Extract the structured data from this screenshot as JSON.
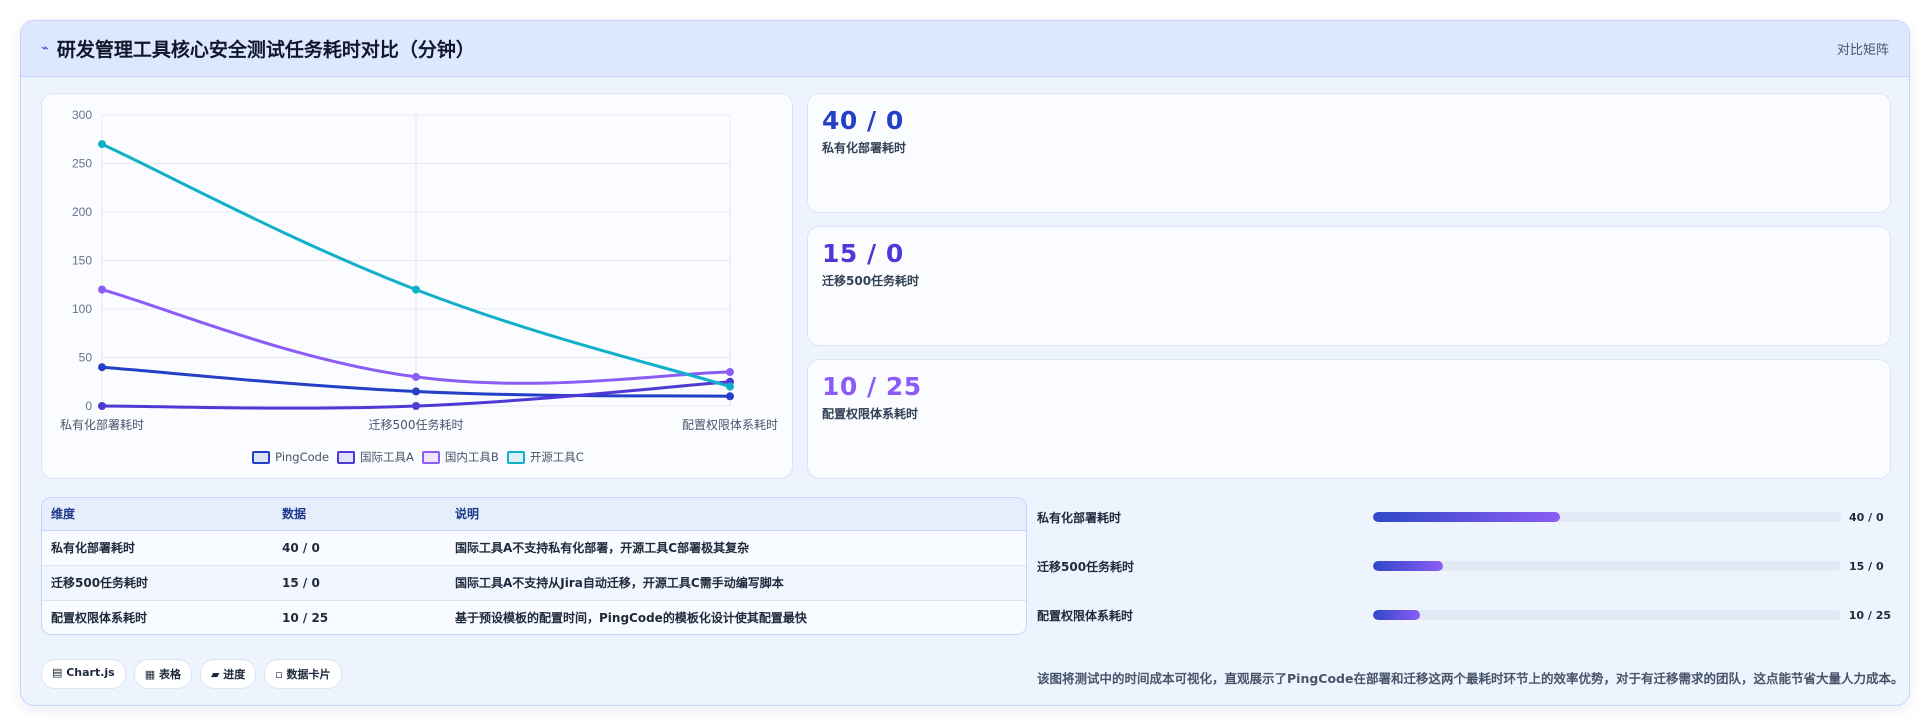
{
  "header": {
    "icon": "chart-line-icon",
    "icon_glyph": "⌁",
    "title": "研发管理工具核心安全测试任务耗时对比（分钟）",
    "right_label": "对比矩阵"
  },
  "stats": [
    {
      "value": "40 / 0",
      "label": "私有化部署耗时",
      "color": "#2440c6"
    },
    {
      "value": "15 / 0",
      "label": "迁移500任务耗时",
      "color": "#4f39d6"
    },
    {
      "value": "10 / 25",
      "label": "配置权限体系耗时",
      "color": "#8b5cf6"
    }
  ],
  "table": {
    "headers": [
      "维度",
      "数据",
      "说明"
    ],
    "rows": [
      [
        "私有化部署耗时",
        "40 / 0",
        "国际工具A不支持私有化部署，开源工具C部署极其复杂"
      ],
      [
        "迁移500任务耗时",
        "15 / 0",
        "国际工具A不支持从Jira自动迁移，开源工具C需手动编写脚本"
      ],
      [
        "配置权限体系耗时",
        "10 / 25",
        "基于预设模板的配置时间，PingCode的模板化设计使其配置最快"
      ]
    ]
  },
  "pills": [
    {
      "icon": "chart-icon",
      "label": "▤ Chart.js"
    },
    {
      "icon": "table-icon",
      "label": "▦ 表格"
    },
    {
      "icon": "progress-icon",
      "label": "▰ 进度"
    },
    {
      "icon": "card-icon",
      "label": "▫ 数据卡片"
    }
  ],
  "progress": [
    {
      "label": "私有化部署耗时",
      "value": "40 / 0",
      "fraction": 0.4
    },
    {
      "label": "迁移500任务耗时",
      "value": "15 / 0",
      "fraction": 0.15
    },
    {
      "label": "配置权限体系耗时",
      "value": "10 / 25",
      "fraction": 0.1
    }
  ],
  "summary": "该图将测试中的时间成本可视化，直观展示了PingCode在部署和迁移这两个最耗时环节上的效率优势，对于有迁移需求的团队，这点能节省大量人力成本。",
  "chart_data": {
    "type": "line",
    "categories": [
      "私有化部署耗时",
      "迁移500任务耗时",
      "配置权限体系耗时"
    ],
    "series": [
      {
        "name": "PingCode",
        "values": [
          40,
          15,
          10
        ],
        "color": "#2440c6"
      },
      {
        "name": "国际工具A",
        "values": [
          0,
          0,
          25
        ],
        "color": "#4f39d6"
      },
      {
        "name": "国内工具B",
        "values": [
          120,
          30,
          35
        ],
        "color": "#8b5cf6"
      },
      {
        "name": "开源工具C",
        "values": [
          270,
          120,
          20
        ],
        "color": "#12b0c8"
      }
    ],
    "title": "",
    "xlabel": "",
    "ylabel": "",
    "ylim": [
      0,
      300
    ],
    "yticks": [
      0,
      50,
      100,
      150,
      200,
      250,
      300
    ],
    "grid": true,
    "legend": "bottom"
  }
}
